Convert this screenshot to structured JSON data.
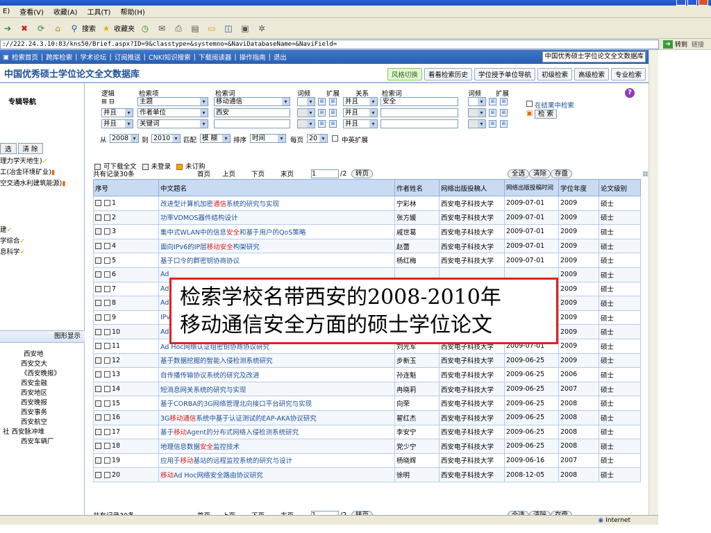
{
  "menu": [
    "E)",
    "查看(V)",
    "收藏(A)",
    "工具(T)",
    "帮助(H)"
  ],
  "toolbar": {
    "search": "搜索",
    "favorites": "收藏夹"
  },
  "address": {
    "url": "://222.24.3.10:83/kns50/Brief.aspx?ID=9&classtype=&systemno=&NaviDatabaseName=&NaviField=",
    "go": "转到",
    "links": "链接"
  },
  "topnav": {
    "items": [
      "检索首页",
      "|",
      "跨库检索",
      "|",
      "学术论坛",
      "|",
      "订阅推送",
      "|",
      "CNKI知识搜索",
      "|",
      "下载阅读器",
      "|",
      "操作指南",
      "|",
      "退出"
    ],
    "db": "中国优秀硕士学位论文全文数据库"
  },
  "header": {
    "title": "中国优秀硕士学位论文全文数据库",
    "buttons": [
      "风格切换",
      "看看检索历史",
      "学位授予单位导航",
      "初级检索",
      "高级检索",
      "专业检索"
    ]
  },
  "sidebar": {
    "title": "专辑导航",
    "buttons": [
      "选",
      "清 除"
    ],
    "items": [
      "理力学天地生)",
      "工(冶金环境矿业)",
      "空交通水利建筑能源)",
      "建",
      "学综合",
      "息科学"
    ],
    "graph": "图形显示",
    "groups": [
      "西安地",
      "西安交大",
      "《西安晚报》",
      "西安金融",
      "西安地区",
      "西安晚报",
      "西安事务",
      "西安航空",
      "社  西安脉冲堆",
      "西安车辆厂"
    ]
  },
  "search": {
    "h_logic": "逻辑",
    "h_item": "检索项",
    "h_word": "检索词",
    "h_freq": "词频",
    "h_ext": "扩展",
    "h_rel": "关系",
    "h_word2": "检索词",
    "h_freq2": "词频",
    "h_ext2": "扩展",
    "plusminus": "⊞ ⊟",
    "rows": [
      {
        "logic": "",
        "field": "主题",
        "word": "移动通信",
        "rel": "并且",
        "word2": "安全"
      },
      {
        "logic": "并且",
        "field": "作者单位",
        "word": "西安",
        "rel": "并且",
        "word2": ""
      },
      {
        "logic": "并且",
        "field": "关键词",
        "word": "",
        "rel": "并且",
        "word2": ""
      }
    ],
    "from": "从",
    "year1": "2008",
    "to": "到",
    "year2": "2010",
    "match": "匹配",
    "matchval": "模 糊",
    "sort": "排序",
    "sortval": "时间",
    "perpage": "每页",
    "perval": "20",
    "zhen": "中英扩展",
    "inresult": "在结果中检索",
    "btn": "检 索"
  },
  "legend": [
    "可下载全文",
    "未登录",
    "未订购"
  ],
  "pager": {
    "total": "共有记录30条",
    "first": "首页",
    "prev": "上页",
    "next": "下页",
    "last": "末页",
    "page": "1",
    "of": "/2",
    "jump": "转页",
    "all": "全选",
    "clear": "清除",
    "save": "存盘"
  },
  "table": {
    "headers": [
      "序号",
      "中文题名",
      "作者姓名",
      "网络出版投稿人",
      "网络出版投稿时间",
      "学位年度",
      "论文级别"
    ],
    "rows": [
      {
        "n": "1",
        "pre": "改进型计算机加密",
        "hl": "通信",
        "post": "系统的研究与实现",
        "a": "宁彩林",
        "u": "西安电子科技大学",
        "d": "2009-07-01",
        "y": "2009",
        "l": "硕士"
      },
      {
        "n": "2",
        "pre": "功率VDMOS器件结构设计",
        "hl": "",
        "post": "",
        "a": "张方媛",
        "u": "西安电子科技大学",
        "d": "2009-07-01",
        "y": "2009",
        "l": "硕士"
      },
      {
        "n": "3",
        "pre": "集中式WLAN中的信息",
        "hl": "安全",
        "post": "和基于用户的QoS策略",
        "a": "戚世葛",
        "u": "西安电子科技大学",
        "d": "2009-07-01",
        "y": "2009",
        "l": "硕士"
      },
      {
        "n": "4",
        "pre": "面向IPv6的IP层",
        "hl": "移动安全",
        "post": "构架研究",
        "a": "赵蕾",
        "u": "西安电子科技大学",
        "d": "2009-07-01",
        "y": "2009",
        "l": "硕士"
      },
      {
        "n": "5",
        "pre": "基于口令的群密钥协商协议",
        "hl": "",
        "post": "",
        "a": "杨红梅",
        "u": "西安电子科技大学",
        "d": "2009-07-01",
        "y": "2009",
        "l": "硕士"
      },
      {
        "n": "6",
        "pre": "Ad",
        "hl": "",
        "post": "",
        "a": "",
        "u": "",
        "d": "",
        "y": "2009",
        "l": "硕士"
      },
      {
        "n": "7",
        "pre": "Ad",
        "hl": "",
        "post": "",
        "a": "",
        "u": "",
        "d": "",
        "y": "2009",
        "l": "硕士"
      },
      {
        "n": "8",
        "pre": "Ad",
        "hl": "",
        "post": "",
        "a": "",
        "u": "",
        "d": "",
        "y": "2009",
        "l": "硕士"
      },
      {
        "n": "9",
        "pre": "IPv",
        "hl": "",
        "post": "",
        "a": "",
        "u": "",
        "d": "",
        "y": "2009",
        "l": "硕士"
      },
      {
        "n": "10",
        "pre": "Ad",
        "hl": "",
        "post": "",
        "a": "",
        "u": "",
        "d": "",
        "y": "2009",
        "l": "硕士"
      },
      {
        "n": "11",
        "pre": "Ad Hoc网络认证组密钥协商协议研究",
        "hl": "",
        "post": "",
        "a": "刘光军",
        "u": "西安电子科技大学",
        "d": "2009-07-01",
        "y": "2009",
        "l": "硕士"
      },
      {
        "n": "12",
        "pre": "基于数据挖掘的智能入侵检测系统研究",
        "hl": "",
        "post": "",
        "a": "步新玉",
        "u": "西安电子科技大学",
        "d": "2009-06-25",
        "y": "2009",
        "l": "硕士"
      },
      {
        "n": "13",
        "pre": "自传播传输协议系统的研究及改进",
        "hl": "",
        "post": "",
        "a": "孙连魁",
        "u": "西安电子科技大学",
        "d": "2009-06-25",
        "y": "2006",
        "l": "硕士"
      },
      {
        "n": "14",
        "pre": "短消息网关系统的研究与实现",
        "hl": "",
        "post": "",
        "a": "冉晓莉",
        "u": "西安电子科技大学",
        "d": "2009-06-25",
        "y": "2007",
        "l": "硕士"
      },
      {
        "n": "15",
        "pre": "基于CORBA的3G网络管理北向接口平台研究与实现",
        "hl": "",
        "post": "",
        "a": "向荣",
        "u": "西安电子科技大学",
        "d": "2009-06-25",
        "y": "2008",
        "l": "硕士"
      },
      {
        "n": "16",
        "pre": "3G",
        "hl": "移动通信",
        "post": "系统中基于认证测试的EAP-AKA协议研究",
        "a": "翟红杰",
        "u": "西安电子科技大学",
        "d": "2009-06-25",
        "y": "2008",
        "l": "硕士"
      },
      {
        "n": "17",
        "pre": "基于",
        "hl": "移动",
        "post": "Agent的分布式网络入侵检测系统研究",
        "a": "李安宁",
        "u": "西安电子科技大学",
        "d": "2009-06-25",
        "y": "2008",
        "l": "硕士"
      },
      {
        "n": "18",
        "pre": "地理信息数据",
        "hl": "安全",
        "post": "监控技术",
        "a": "党少宁",
        "u": "西安电子科技大学",
        "d": "2009-06-25",
        "y": "2008",
        "l": "硕士"
      },
      {
        "n": "19",
        "pre": "应用于",
        "hl": "移动",
        "post": "基站的远程监控系统的研究与设计",
        "a": "杨晓辉",
        "u": "西安电子科技大学",
        "d": "2009-06-16",
        "y": "2007",
        "l": "硕士"
      },
      {
        "n": "20",
        "pre": "",
        "hl": "移动",
        "post": "Ad Hoc网络安全路由协议研究",
        "a": "徐明",
        "u": "西安电子科技大学",
        "d": "2008-12-05",
        "y": "2008",
        "l": "硕士"
      }
    ]
  },
  "callout": {
    "line1": "检索学校名带西安的2008-2010年",
    "line2": "移动通信安全方面的硕士学位论文"
  },
  "status": {
    "zone": "Internet"
  },
  "colors": {
    "highlight": "#d81b1b",
    "nav": "#2a5fb0",
    "callout_border": "#e0201e"
  }
}
